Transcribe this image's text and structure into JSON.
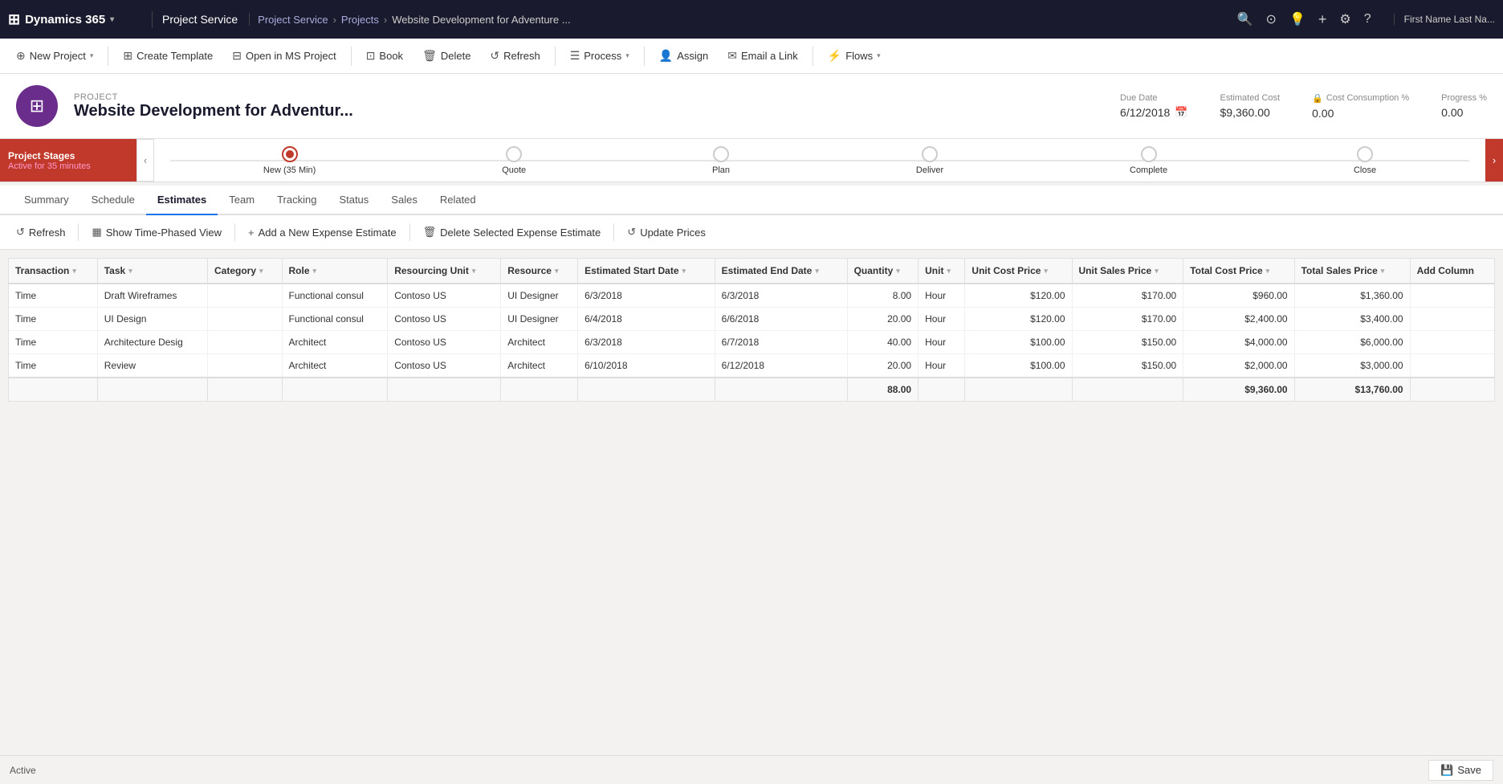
{
  "topNav": {
    "brand": "Dynamics 365",
    "chevron": "▾",
    "moduleName": "Project Service",
    "breadcrumbs": [
      "Project Service",
      "Projects",
      "Website Development for Adventure ..."
    ],
    "breadcrumbSep": "›",
    "icons": [
      "🔍",
      "⊙",
      "💡",
      "+",
      "⚙",
      "?"
    ],
    "user": "First Name Last Na..."
  },
  "commandBar": {
    "buttons": [
      {
        "id": "new-project",
        "icon": "⊕",
        "label": "New Project",
        "hasCaret": true
      },
      {
        "id": "create-template",
        "icon": "⊞",
        "label": "Create Template"
      },
      {
        "id": "open-ms-project",
        "icon": "⊟",
        "label": "Open in MS Project"
      },
      {
        "id": "book",
        "icon": "⊡",
        "label": "Book"
      },
      {
        "id": "delete",
        "icon": "🗑",
        "label": "Delete"
      },
      {
        "id": "refresh",
        "icon": "↺",
        "label": "Refresh"
      },
      {
        "id": "process",
        "icon": "☰",
        "label": "Process",
        "hasCaret": true
      },
      {
        "id": "assign",
        "icon": "👤",
        "label": "Assign"
      },
      {
        "id": "email-link",
        "icon": "✉",
        "label": "Email a Link"
      },
      {
        "id": "flows",
        "icon": "⚡",
        "label": "Flows",
        "hasCaret": true
      }
    ]
  },
  "project": {
    "label": "PROJECT",
    "name": "Website Development for Adventur...",
    "dueDate": {
      "label": "Due Date",
      "value": "6/12/2018"
    },
    "estimatedCost": {
      "label": "Estimated Cost",
      "value": "$9,360.00"
    },
    "costConsumption": {
      "label": "Cost Consumption %",
      "value": "0.00"
    },
    "progress": {
      "label": "Progress %",
      "value": "0.00"
    }
  },
  "stages": {
    "label": "Project Stages",
    "subLabel": "Active for 35 minutes",
    "steps": [
      {
        "id": "new",
        "name": "New  (35 Min)",
        "active": true
      },
      {
        "id": "quote",
        "name": "Quote",
        "active": false
      },
      {
        "id": "plan",
        "name": "Plan",
        "active": false
      },
      {
        "id": "deliver",
        "name": "Deliver",
        "active": false
      },
      {
        "id": "complete",
        "name": "Complete",
        "active": false
      },
      {
        "id": "close",
        "name": "Close",
        "active": false
      }
    ]
  },
  "tabs": [
    {
      "id": "summary",
      "label": "Summary",
      "active": false
    },
    {
      "id": "schedule",
      "label": "Schedule",
      "active": false
    },
    {
      "id": "estimates",
      "label": "Estimates",
      "active": true
    },
    {
      "id": "team",
      "label": "Team",
      "active": false
    },
    {
      "id": "tracking",
      "label": "Tracking",
      "active": false
    },
    {
      "id": "status",
      "label": "Status",
      "active": false
    },
    {
      "id": "sales",
      "label": "Sales",
      "active": false
    },
    {
      "id": "related",
      "label": "Related",
      "active": false
    }
  ],
  "estimatesToolbar": {
    "buttons": [
      {
        "id": "refresh",
        "icon": "↺",
        "label": "Refresh"
      },
      {
        "id": "time-phased",
        "icon": "▦",
        "label": "Show Time-Phased View"
      },
      {
        "id": "add-expense",
        "icon": "+",
        "label": "Add a New Expense Estimate"
      },
      {
        "id": "delete-expense",
        "icon": "🗑",
        "label": "Delete Selected Expense Estimate"
      },
      {
        "id": "update-prices",
        "icon": "↺",
        "label": "Update Prices"
      }
    ]
  },
  "table": {
    "columns": [
      {
        "id": "transaction",
        "label": "Transaction"
      },
      {
        "id": "task",
        "label": "Task"
      },
      {
        "id": "category",
        "label": "Category"
      },
      {
        "id": "role",
        "label": "Role"
      },
      {
        "id": "resourcing-unit",
        "label": "Resourcing Unit"
      },
      {
        "id": "resource",
        "label": "Resource"
      },
      {
        "id": "start-date",
        "label": "Estimated Start Date"
      },
      {
        "id": "end-date",
        "label": "Estimated End Date"
      },
      {
        "id": "quantity",
        "label": "Quantity"
      },
      {
        "id": "unit",
        "label": "Unit"
      },
      {
        "id": "unit-cost-price",
        "label": "Unit Cost Price"
      },
      {
        "id": "unit-sales-price",
        "label": "Unit Sales Price"
      },
      {
        "id": "total-cost-price",
        "label": "Total Cost Price"
      },
      {
        "id": "total-sales-price",
        "label": "Total Sales Price"
      },
      {
        "id": "add-column",
        "label": "Add Column"
      }
    ],
    "rows": [
      {
        "transaction": "Time",
        "task": "Draft Wireframes",
        "category": "",
        "role": "Functional consul",
        "resourcingUnit": "Contoso US",
        "resource": "UI Designer",
        "startDate": "6/3/2018",
        "endDate": "6/3/2018",
        "quantity": "8.00",
        "unit": "Hour",
        "unitCostPrice": "$120.00",
        "unitSalesPrice": "$170.00",
        "totalCostPrice": "$960.00",
        "totalSalesPrice": "$1,360.00"
      },
      {
        "transaction": "Time",
        "task": "UI Design",
        "category": "",
        "role": "Functional consul",
        "resourcingUnit": "Contoso US",
        "resource": "UI Designer",
        "startDate": "6/4/2018",
        "endDate": "6/6/2018",
        "quantity": "20.00",
        "unit": "Hour",
        "unitCostPrice": "$120.00",
        "unitSalesPrice": "$170.00",
        "totalCostPrice": "$2,400.00",
        "totalSalesPrice": "$3,400.00"
      },
      {
        "transaction": "Time",
        "task": "Architecture Desig",
        "category": "",
        "role": "Architect",
        "resourcingUnit": "Contoso US",
        "resource": "Architect",
        "startDate": "6/3/2018",
        "endDate": "6/7/2018",
        "quantity": "40.00",
        "unit": "Hour",
        "unitCostPrice": "$100.00",
        "unitSalesPrice": "$150.00",
        "totalCostPrice": "$4,000.00",
        "totalSalesPrice": "$6,000.00"
      },
      {
        "transaction": "Time",
        "task": "Review",
        "category": "",
        "role": "Architect",
        "resourcingUnit": "Contoso US",
        "resource": "Architect",
        "startDate": "6/10/2018",
        "endDate": "6/12/2018",
        "quantity": "20.00",
        "unit": "Hour",
        "unitCostPrice": "$100.00",
        "unitSalesPrice": "$150.00",
        "totalCostPrice": "$2,000.00",
        "totalSalesPrice": "$3,000.00"
      }
    ],
    "footer": {
      "quantity": "88.00",
      "totalCostPrice": "$9,360.00",
      "totalSalesPrice": "$13,760.00"
    }
  },
  "bottomBar": {
    "status": "Active",
    "saveLabel": "💾  Save"
  }
}
